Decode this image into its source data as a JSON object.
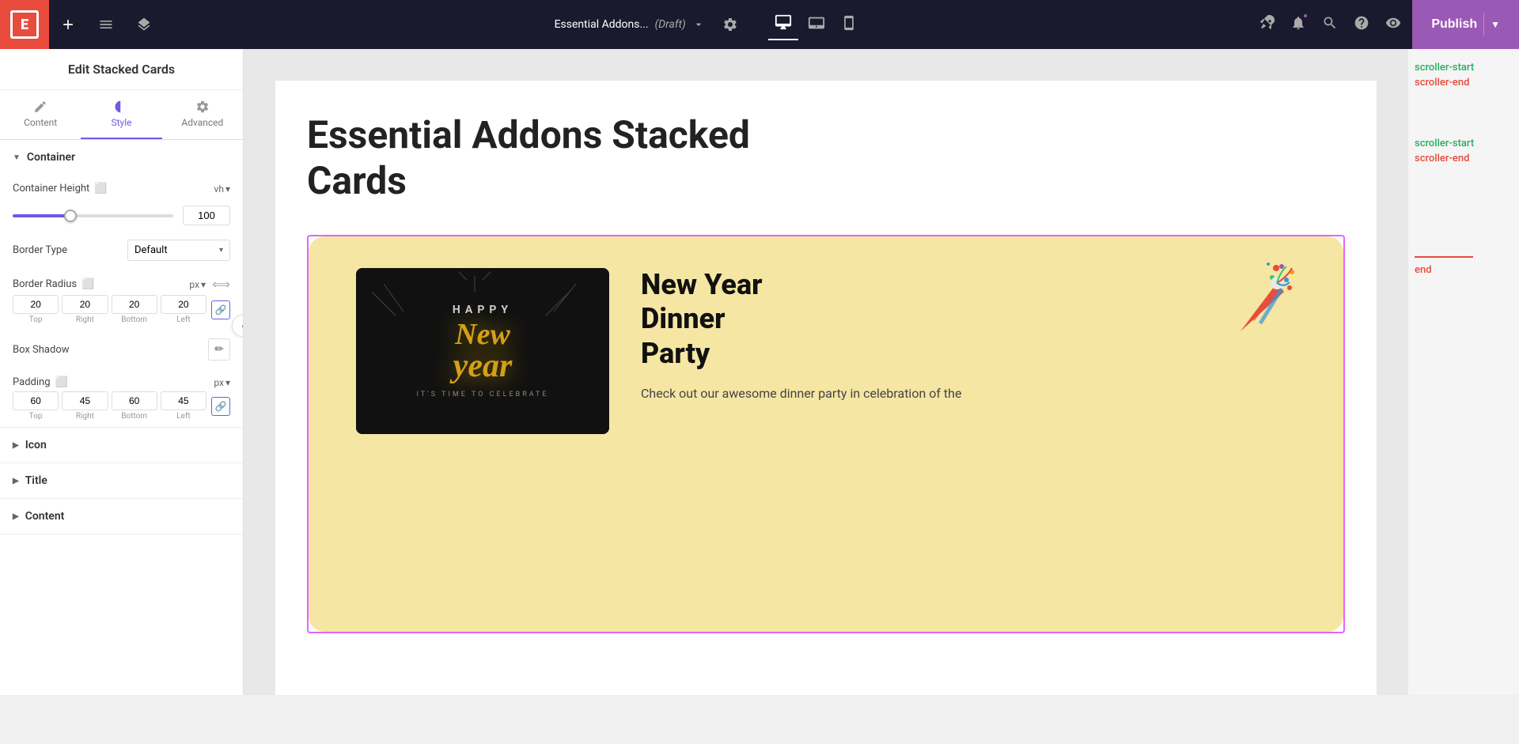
{
  "header": {
    "logo_letter": "E",
    "page_title": "Essential Addons...",
    "page_status": "(Draft)",
    "publish_label": "Publish",
    "settings_label": "Settings",
    "tabs": {
      "add_label": "+",
      "hamburger_label": "☰",
      "layers_label": "⊞"
    },
    "devices": [
      "desktop",
      "tablet",
      "mobile"
    ],
    "active_device": "desktop"
  },
  "left_panel": {
    "title": "Edit Stacked Cards",
    "tabs": [
      {
        "id": "content",
        "label": "Content",
        "icon": "pen"
      },
      {
        "id": "style",
        "label": "Style",
        "icon": "half-circle",
        "active": true
      },
      {
        "id": "advanced",
        "label": "Advanced",
        "icon": "gear"
      }
    ],
    "sections": {
      "container": {
        "label": "Container",
        "expanded": true,
        "container_height": {
          "label": "Container Height",
          "unit": "vh",
          "value": "100",
          "slider_percent": 36
        },
        "border_type": {
          "label": "Border Type",
          "value": "Default"
        },
        "border_radius": {
          "label": "Border Radius",
          "unit": "px",
          "values": {
            "top": "20",
            "right": "20",
            "bottom": "20",
            "left": "20"
          },
          "linked": true
        },
        "box_shadow": {
          "label": "Box Shadow"
        },
        "padding": {
          "label": "Padding",
          "unit": "px",
          "values": {
            "top": "60",
            "right": "45",
            "bottom": "60",
            "left": "45"
          },
          "linked": true
        }
      },
      "icon": {
        "label": "Icon"
      },
      "title": {
        "label": "Title"
      },
      "content_section": {
        "label": "Content"
      }
    }
  },
  "canvas": {
    "page_heading": "Essential Addons Stacked\nCards",
    "card": {
      "title": "New Year\nDinner\nParty",
      "description": "Check out our awesome dinner party in celebration of the",
      "image_text": "HAPPY",
      "image_script": "New year",
      "image_sub": "IT'S TIME TO CELEBRATE",
      "background_color": "#f5e6a3"
    }
  },
  "right_panel": {
    "markers": [
      {
        "text": "scroller-start",
        "color": "green"
      },
      {
        "text": "scroller-end",
        "color": "red"
      },
      {
        "text": "scroller-start",
        "color": "green"
      },
      {
        "text": "scroller-end",
        "color": "red"
      },
      {
        "text": "end",
        "color": "red",
        "has_line": true
      }
    ]
  }
}
